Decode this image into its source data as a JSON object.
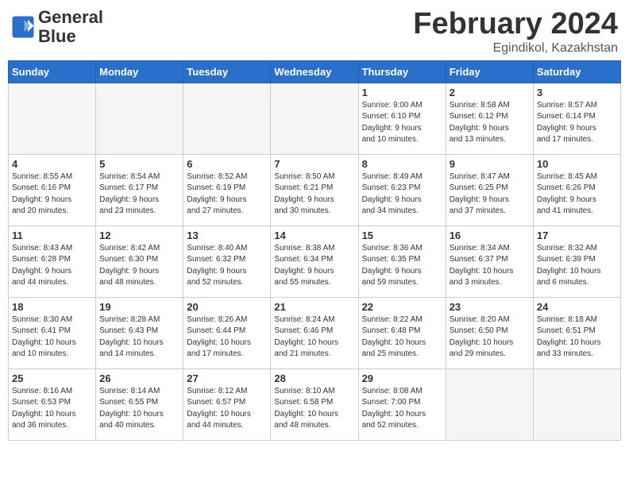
{
  "header": {
    "logo_line1": "General",
    "logo_line2": "Blue",
    "month_year": "February 2024",
    "location": "Egindikol, Kazakhstan"
  },
  "weekdays": [
    "Sunday",
    "Monday",
    "Tuesday",
    "Wednesday",
    "Thursday",
    "Friday",
    "Saturday"
  ],
  "weeks": [
    [
      {
        "day": "",
        "info": ""
      },
      {
        "day": "",
        "info": ""
      },
      {
        "day": "",
        "info": ""
      },
      {
        "day": "",
        "info": ""
      },
      {
        "day": "1",
        "info": "Sunrise: 9:00 AM\nSunset: 6:10 PM\nDaylight: 9 hours\nand 10 minutes."
      },
      {
        "day": "2",
        "info": "Sunrise: 8:58 AM\nSunset: 6:12 PM\nDaylight: 9 hours\nand 13 minutes."
      },
      {
        "day": "3",
        "info": "Sunrise: 8:57 AM\nSunset: 6:14 PM\nDaylight: 9 hours\nand 17 minutes."
      }
    ],
    [
      {
        "day": "4",
        "info": "Sunrise: 8:55 AM\nSunset: 6:16 PM\nDaylight: 9 hours\nand 20 minutes."
      },
      {
        "day": "5",
        "info": "Sunrise: 8:54 AM\nSunset: 6:17 PM\nDaylight: 9 hours\nand 23 minutes."
      },
      {
        "day": "6",
        "info": "Sunrise: 8:52 AM\nSunset: 6:19 PM\nDaylight: 9 hours\nand 27 minutes."
      },
      {
        "day": "7",
        "info": "Sunrise: 8:50 AM\nSunset: 6:21 PM\nDaylight: 9 hours\nand 30 minutes."
      },
      {
        "day": "8",
        "info": "Sunrise: 8:49 AM\nSunset: 6:23 PM\nDaylight: 9 hours\nand 34 minutes."
      },
      {
        "day": "9",
        "info": "Sunrise: 8:47 AM\nSunset: 6:25 PM\nDaylight: 9 hours\nand 37 minutes."
      },
      {
        "day": "10",
        "info": "Sunrise: 8:45 AM\nSunset: 6:26 PM\nDaylight: 9 hours\nand 41 minutes."
      }
    ],
    [
      {
        "day": "11",
        "info": "Sunrise: 8:43 AM\nSunset: 6:28 PM\nDaylight: 9 hours\nand 44 minutes."
      },
      {
        "day": "12",
        "info": "Sunrise: 8:42 AM\nSunset: 6:30 PM\nDaylight: 9 hours\nand 48 minutes."
      },
      {
        "day": "13",
        "info": "Sunrise: 8:40 AM\nSunset: 6:32 PM\nDaylight: 9 hours\nand 52 minutes."
      },
      {
        "day": "14",
        "info": "Sunrise: 8:38 AM\nSunset: 6:34 PM\nDaylight: 9 hours\nand 55 minutes."
      },
      {
        "day": "15",
        "info": "Sunrise: 8:36 AM\nSunset: 6:35 PM\nDaylight: 9 hours\nand 59 minutes."
      },
      {
        "day": "16",
        "info": "Sunrise: 8:34 AM\nSunset: 6:37 PM\nDaylight: 10 hours\nand 3 minutes."
      },
      {
        "day": "17",
        "info": "Sunrise: 8:32 AM\nSunset: 6:39 PM\nDaylight: 10 hours\nand 6 minutes."
      }
    ],
    [
      {
        "day": "18",
        "info": "Sunrise: 8:30 AM\nSunset: 6:41 PM\nDaylight: 10 hours\nand 10 minutes."
      },
      {
        "day": "19",
        "info": "Sunrise: 8:28 AM\nSunset: 6:43 PM\nDaylight: 10 hours\nand 14 minutes."
      },
      {
        "day": "20",
        "info": "Sunrise: 8:26 AM\nSunset: 6:44 PM\nDaylight: 10 hours\nand 17 minutes."
      },
      {
        "day": "21",
        "info": "Sunrise: 8:24 AM\nSunset: 6:46 PM\nDaylight: 10 hours\nand 21 minutes."
      },
      {
        "day": "22",
        "info": "Sunrise: 8:22 AM\nSunset: 6:48 PM\nDaylight: 10 hours\nand 25 minutes."
      },
      {
        "day": "23",
        "info": "Sunrise: 8:20 AM\nSunset: 6:50 PM\nDaylight: 10 hours\nand 29 minutes."
      },
      {
        "day": "24",
        "info": "Sunrise: 8:18 AM\nSunset: 6:51 PM\nDaylight: 10 hours\nand 33 minutes."
      }
    ],
    [
      {
        "day": "25",
        "info": "Sunrise: 8:16 AM\nSunset: 6:53 PM\nDaylight: 10 hours\nand 36 minutes."
      },
      {
        "day": "26",
        "info": "Sunrise: 8:14 AM\nSunset: 6:55 PM\nDaylight: 10 hours\nand 40 minutes."
      },
      {
        "day": "27",
        "info": "Sunrise: 8:12 AM\nSunset: 6:57 PM\nDaylight: 10 hours\nand 44 minutes."
      },
      {
        "day": "28",
        "info": "Sunrise: 8:10 AM\nSunset: 6:58 PM\nDaylight: 10 hours\nand 48 minutes."
      },
      {
        "day": "29",
        "info": "Sunrise: 8:08 AM\nSunset: 7:00 PM\nDaylight: 10 hours\nand 52 minutes."
      },
      {
        "day": "",
        "info": ""
      },
      {
        "day": "",
        "info": ""
      }
    ]
  ]
}
